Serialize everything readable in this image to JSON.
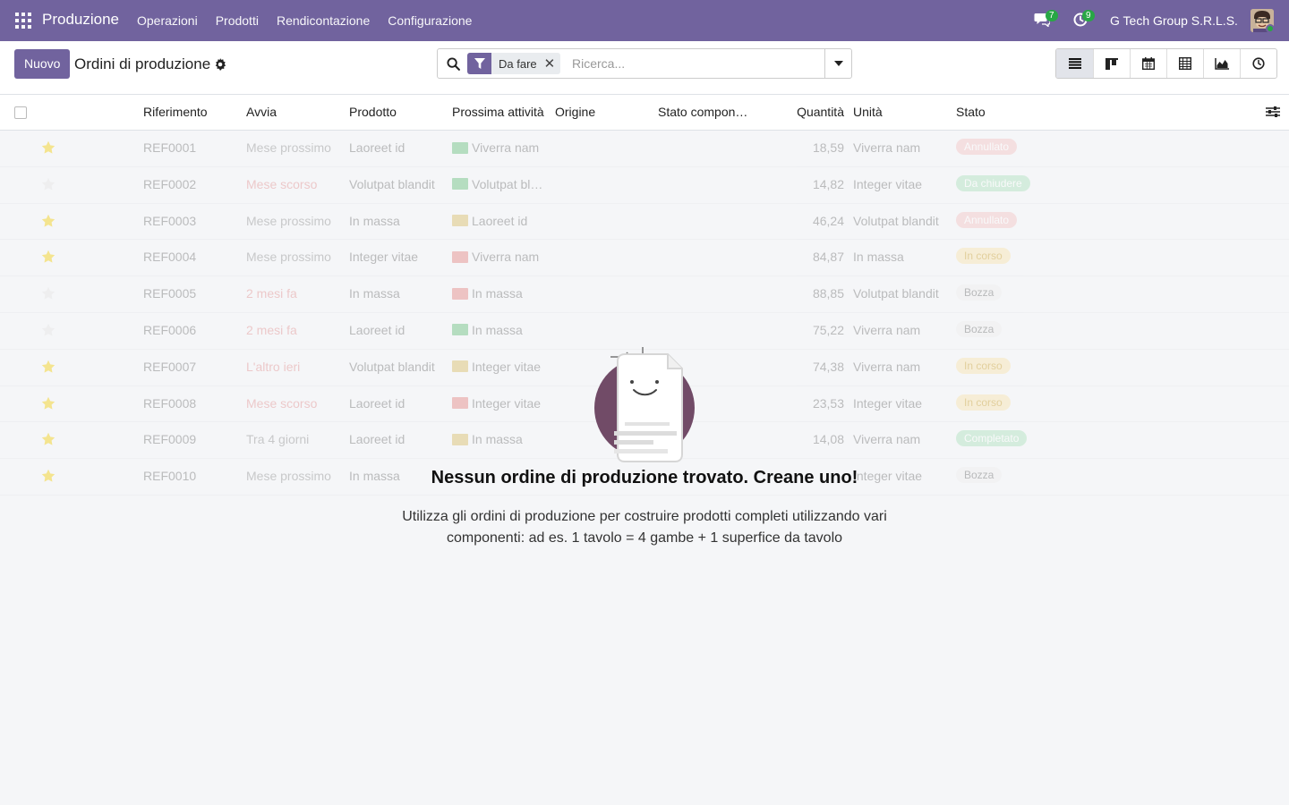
{
  "navbar": {
    "app_name": "Produzione",
    "menu": [
      "Operazioni",
      "Prodotti",
      "Rendicontazione",
      "Configurazione"
    ],
    "messages_count": "7",
    "activities_count": "9",
    "company": "G Tech Group S.R.L.S."
  },
  "control": {
    "new_button": "Nuovo",
    "title": "Ordini di produzione",
    "facet_label": "Da fare",
    "search_placeholder": "Ricerca...",
    "views": [
      "list",
      "kanban",
      "calendar",
      "pivot",
      "graph",
      "activity"
    ],
    "active_view": "list"
  },
  "list": {
    "headers": {
      "reference": "Riferimento",
      "start": "Avvia",
      "product": "Prodotto",
      "next_activity": "Prossima attività",
      "origin": "Origine",
      "component_status": "Stato compon…",
      "quantity": "Quantità",
      "unit": "Unità",
      "state": "Stato"
    },
    "rows": [
      {
        "starred": true,
        "ref": "REF0001",
        "start": "Mese prossimo",
        "start_color": "#8a8a8a",
        "product": "Laoreet id",
        "activity": "Viverra nam",
        "activity_color": "#28a745",
        "qty": "18,59",
        "unit": "Viverra nam",
        "state": "Annullato",
        "state_bg": "#f3c0c0",
        "state_fg": "#ffffff"
      },
      {
        "starred": false,
        "ref": "REF0002",
        "start": "Mese scorso",
        "start_color": "#e08a8a",
        "product": "Volutpat blandit",
        "activity": "Volutpat bl…",
        "activity_color": "#28a745",
        "qty": "14,82",
        "unit": "Integer vitae",
        "state": "Da chiudere",
        "state_bg": "#a8e0b8",
        "state_fg": "#ffffff"
      },
      {
        "starred": true,
        "ref": "REF0003",
        "start": "Mese prossimo",
        "start_color": "#8a8a8a",
        "product": "In massa",
        "activity": "Laoreet id",
        "activity_color": "#c9a227",
        "qty": "46,24",
        "unit": "Volutpat blandit",
        "state": "Annullato",
        "state_bg": "#f3c0c0",
        "state_fg": "#ffffff"
      },
      {
        "starred": true,
        "ref": "REF0004",
        "start": "Mese prossimo",
        "start_color": "#8a8a8a",
        "product": "Integer vitae",
        "activity": "Viverra nam",
        "activity_color": "#d9534f",
        "qty": "84,87",
        "unit": "In massa",
        "state": "In corso",
        "state_bg": "#f8e2a8",
        "state_fg": "#c89a20"
      },
      {
        "starred": false,
        "ref": "REF0005",
        "start": "2 mesi fa",
        "start_color": "#e08a8a",
        "product": "In massa",
        "activity": "In massa",
        "activity_color": "#d9534f",
        "qty": "88,85",
        "unit": "Volutpat blandit",
        "state": "Bozza",
        "state_bg": "#eeeeee",
        "state_fg": "#666666"
      },
      {
        "starred": false,
        "ref": "REF0006",
        "start": "2 mesi fa",
        "start_color": "#e08a8a",
        "product": "Laoreet id",
        "activity": "In massa",
        "activity_color": "#28a745",
        "qty": "75,22",
        "unit": "Viverra nam",
        "state": "Bozza",
        "state_bg": "#eeeeee",
        "state_fg": "#666666"
      },
      {
        "starred": true,
        "ref": "REF0007",
        "start": "L'altro ieri",
        "start_color": "#e08a8a",
        "product": "Volutpat blandit",
        "activity": "Integer vitae",
        "activity_color": "#c9a227",
        "qty": "74,38",
        "unit": "Viverra nam",
        "state": "In corso",
        "state_bg": "#f8e2a8",
        "state_fg": "#c89a20"
      },
      {
        "starred": true,
        "ref": "REF0008",
        "start": "Mese scorso",
        "start_color": "#e08a8a",
        "product": "Laoreet id",
        "activity": "Integer vitae",
        "activity_color": "#d9534f",
        "qty": "23,53",
        "unit": "Integer vitae",
        "state": "In corso",
        "state_bg": "#f8e2a8",
        "state_fg": "#c89a20"
      },
      {
        "starred": true,
        "ref": "REF0009",
        "start": "Tra 4 giorni",
        "start_color": "#8a8a8a",
        "product": "Laoreet id",
        "activity": "In massa",
        "activity_color": "#c9a227",
        "qty": "14,08",
        "unit": "Viverra nam",
        "state": "Completato",
        "state_bg": "#a8e0b8",
        "state_fg": "#ffffff"
      },
      {
        "starred": true,
        "ref": "REF0010",
        "start": "Mese prossimo",
        "start_color": "#8a8a8a",
        "product": "In massa",
        "activity": "",
        "activity_color": "#c9a227",
        "qty": "",
        "unit": "Integer vitae",
        "state": "Bozza",
        "state_bg": "#eeeeee",
        "state_fg": "#666666"
      }
    ]
  },
  "empty_state": {
    "title": "Nessun ordine di produzione trovato. Creane uno!",
    "description": "Utilizza gli ordini di produzione per costruire prodotti completi utilizzando vari componenti: ad es. 1 tavolo = 4 gambe + 1 superfice da tavolo"
  },
  "colors": {
    "brand": "#71639e",
    "success": "#28a745",
    "star": "#f3cc00"
  }
}
